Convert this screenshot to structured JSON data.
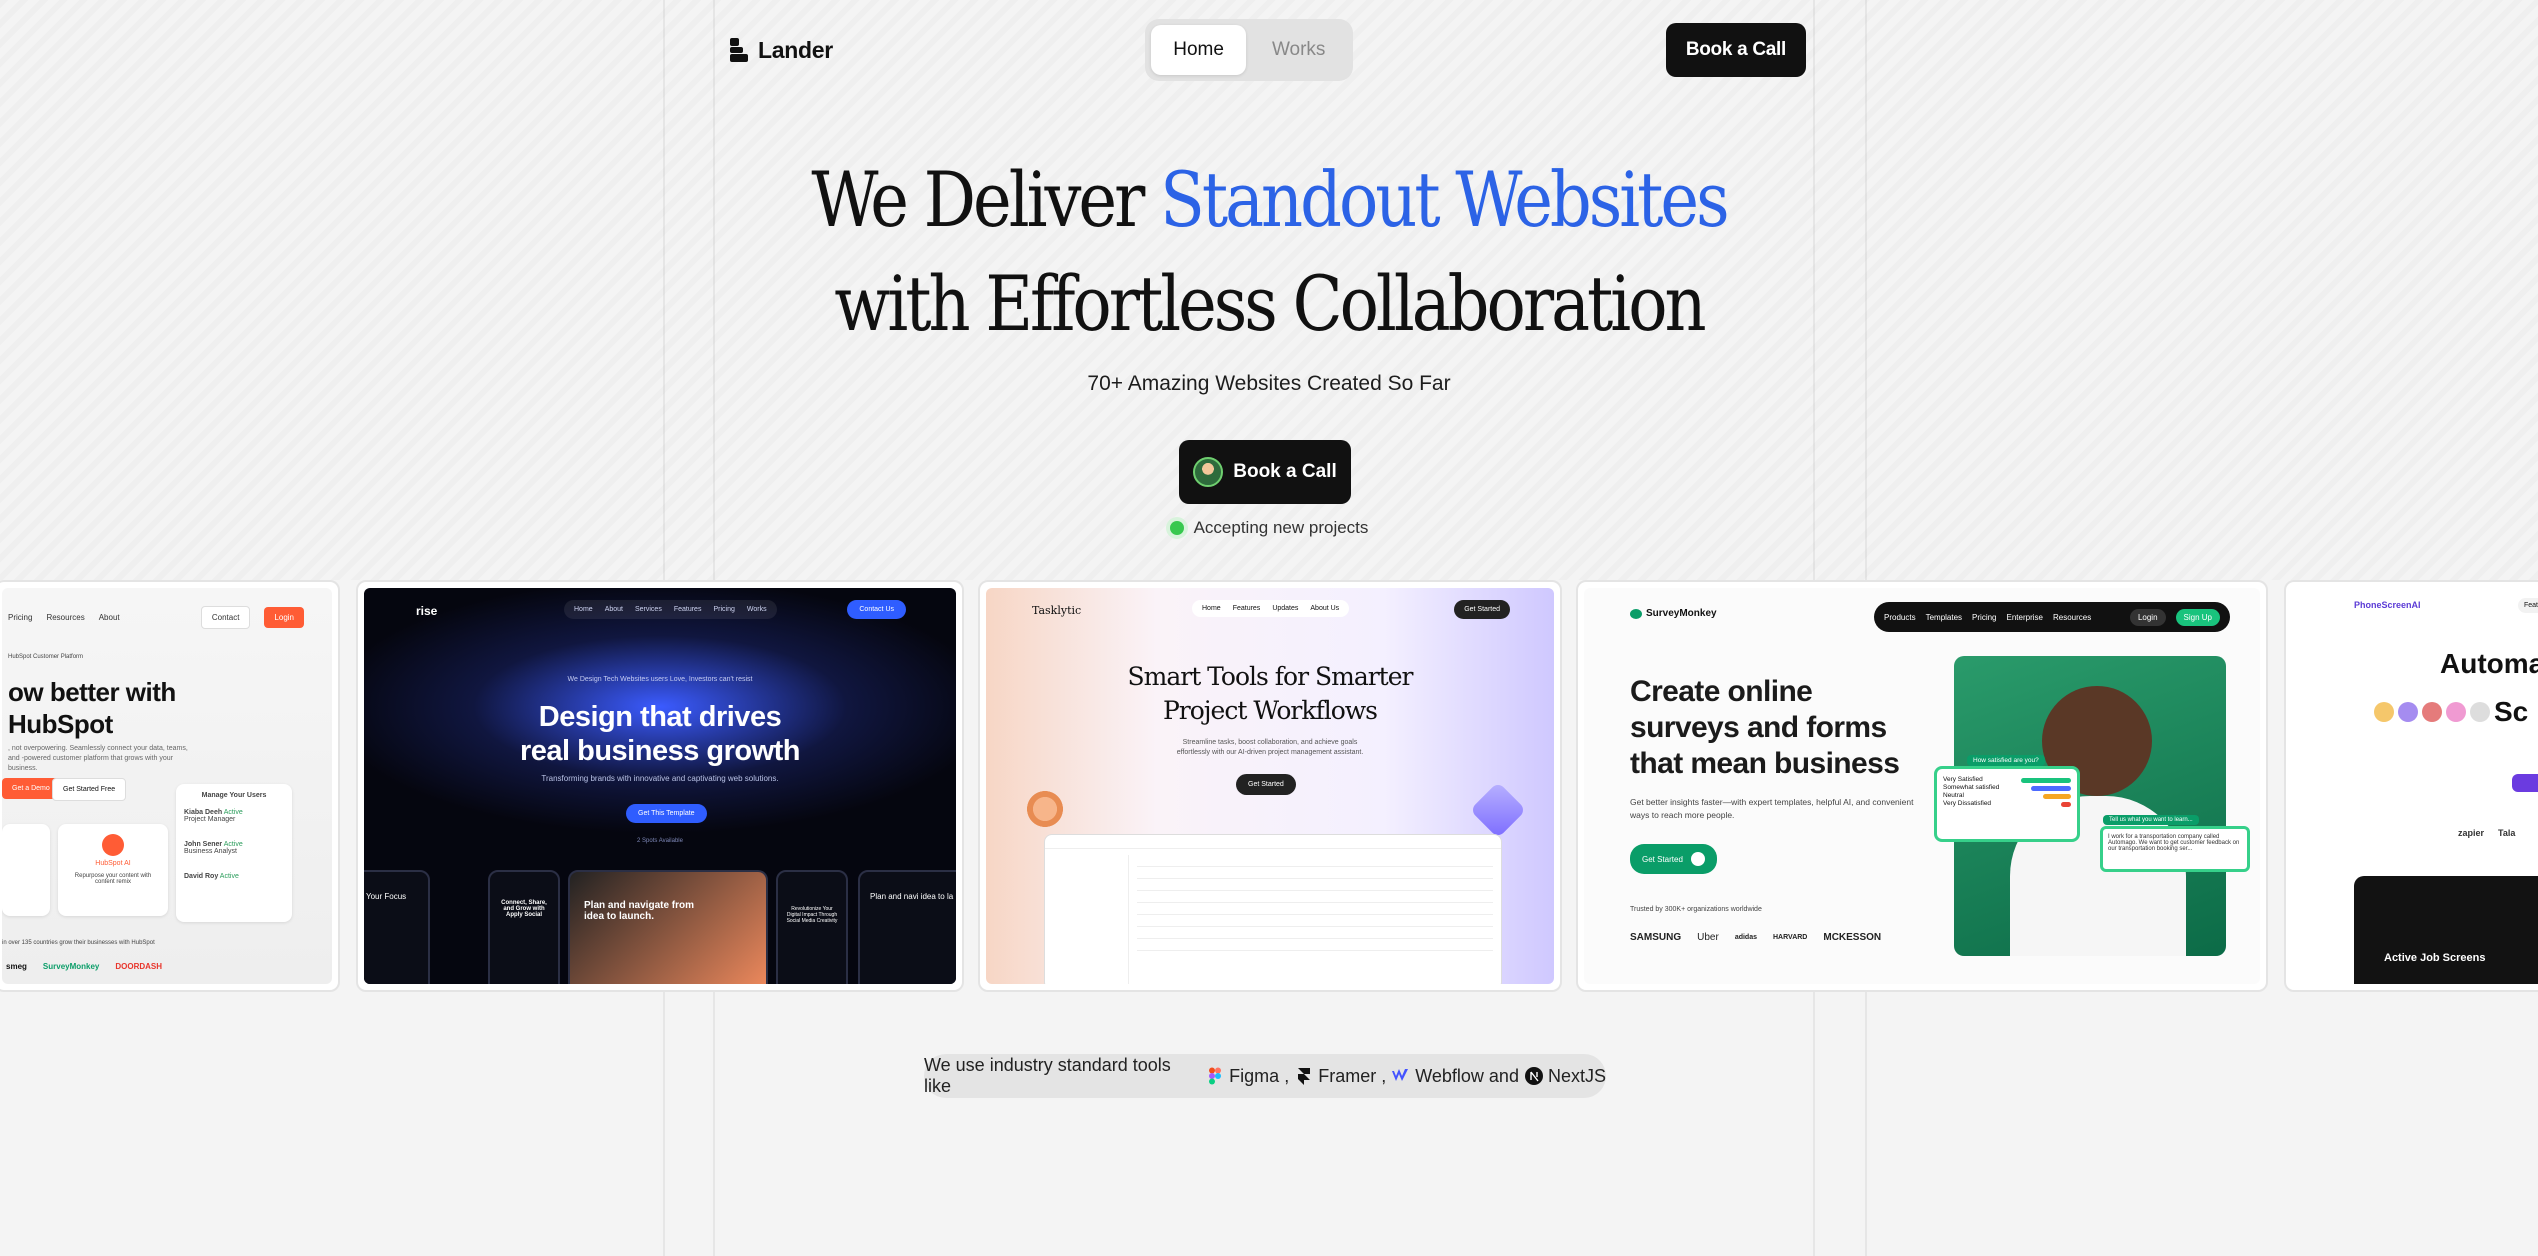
{
  "nav": {
    "brand": "Lander",
    "tabs": [
      {
        "label": "Home",
        "active": true
      },
      {
        "label": "Works",
        "active": false
      }
    ],
    "cta": "Book a Call"
  },
  "hero": {
    "title_line1_plain": "We Deliver ",
    "title_line1_accent": "Standout Websites",
    "title_line2": "with Effortless Collaboration",
    "subtitle": "70+ Amazing Websites Created So Far",
    "cta": "Book a Call",
    "status": "Accepting new projects",
    "accent_color": "#2c63e6"
  },
  "cards": {
    "hubspot": {
      "nav_items": [
        "Pricing",
        "Resources",
        "About"
      ],
      "contact": "Contact",
      "login": "Login",
      "badge": "HubSpot Customer Platform",
      "headline1": "ow better with",
      "headline2": "HubSpot",
      "desc": ", not overpowering. Seamlessly connect your data, teams, and -powered customer platform that grows with your business.",
      "btn_demo": "Get a Demo",
      "btn_free": "Get Started Free",
      "manage_title": "Manage Your Users",
      "users": [
        {
          "name": "Kiaba Deeh",
          "role": "Project Manager",
          "status": "Active"
        },
        {
          "name": "John Sener",
          "role": "Business Analyst",
          "status": "Active"
        },
        {
          "name": "David Roy",
          "role": "",
          "status": "Active"
        }
      ],
      "repurpose": "Repurpose your content with content remix",
      "hub_label": "HubSpot AI",
      "footer": "in over 135 countries grow their businesses with HubSpot",
      "logos": [
        "smeg",
        "SurveyMonkey",
        "DOORDASH"
      ]
    },
    "arise": {
      "brand": "rise",
      "nav_items": [
        "Home",
        "About",
        "Services",
        "Features",
        "Pricing",
        "Works"
      ],
      "contact": "Contact Us",
      "tagline": "We Design Tech Websites users Love, Investors can't resist",
      "headline1": "Design that drives",
      "headline2": "real business growth",
      "desc": "Transforming brands with innovative and captivating web solutions.",
      "cta": "Get This Template",
      "spots": "2 Spots Available",
      "screens": [
        "Your Focus",
        "Connect, Share, and Grow with Apply Social",
        "Plan and navigate from idea to launch.",
        "Revolutionize Your Digital Impact Through Social Media Creativity",
        "Plan and navi idea to la"
      ]
    },
    "tasklytic": {
      "brand": "Tasklytic",
      "nav_items": [
        "Home",
        "Features",
        "Updates",
        "About Us"
      ],
      "cta_nav": "Get Started",
      "headline1": "Smart Tools for Smarter",
      "headline2": "Project Workflows",
      "desc": "Streamline tasks, boost collaboration, and achieve goals effortlessly with our AI-driven project management assistant.",
      "cta": "Get Started"
    },
    "surveymonkey": {
      "brand": "SurveyMonkey",
      "nav_items": [
        "Products",
        "Templates",
        "Pricing",
        "Enterprise",
        "Resources"
      ],
      "login": "Login",
      "signup": "Sign Up",
      "headline1": "Create online",
      "headline2": "surveys and forms",
      "headline3": "that mean business",
      "desc": "Get better insights faster—with expert templates, helpful AI, and convenient ways to reach more people.",
      "cta": "Get Started",
      "trusted": "Trusted by 300K+ organizations worldwide",
      "logos": [
        "SAMSUNG",
        "Uber",
        "adidas",
        "HARVARD",
        "MCKESSON"
      ],
      "survey_title": "How satisfied are you?",
      "survey_options": [
        "Very Satisfied",
        "Somewhat satisfied",
        "Neutral",
        "Very Dissatisfied"
      ],
      "chat_title": "Tell us what you want to learn...",
      "chat_text": "I work for a transportation company called Automago. We want to get customer feedback on our transportation booking ser..."
    },
    "phonescreen": {
      "brand": "PhoneScreenAI",
      "features": "Features",
      "headline1": "Automa",
      "headline2": "Sc",
      "logos": [
        "zapier",
        "Tala"
      ],
      "screen_title": "Active Job Screens"
    }
  },
  "tools": {
    "prefix": "We use industry standard tools like",
    "items": [
      {
        "name": "Figma",
        "sep": ","
      },
      {
        "name": "Framer",
        "sep": ","
      },
      {
        "name": "Webflow",
        "sep": "and"
      },
      {
        "name": "NextJS",
        "sep": ""
      }
    ]
  }
}
